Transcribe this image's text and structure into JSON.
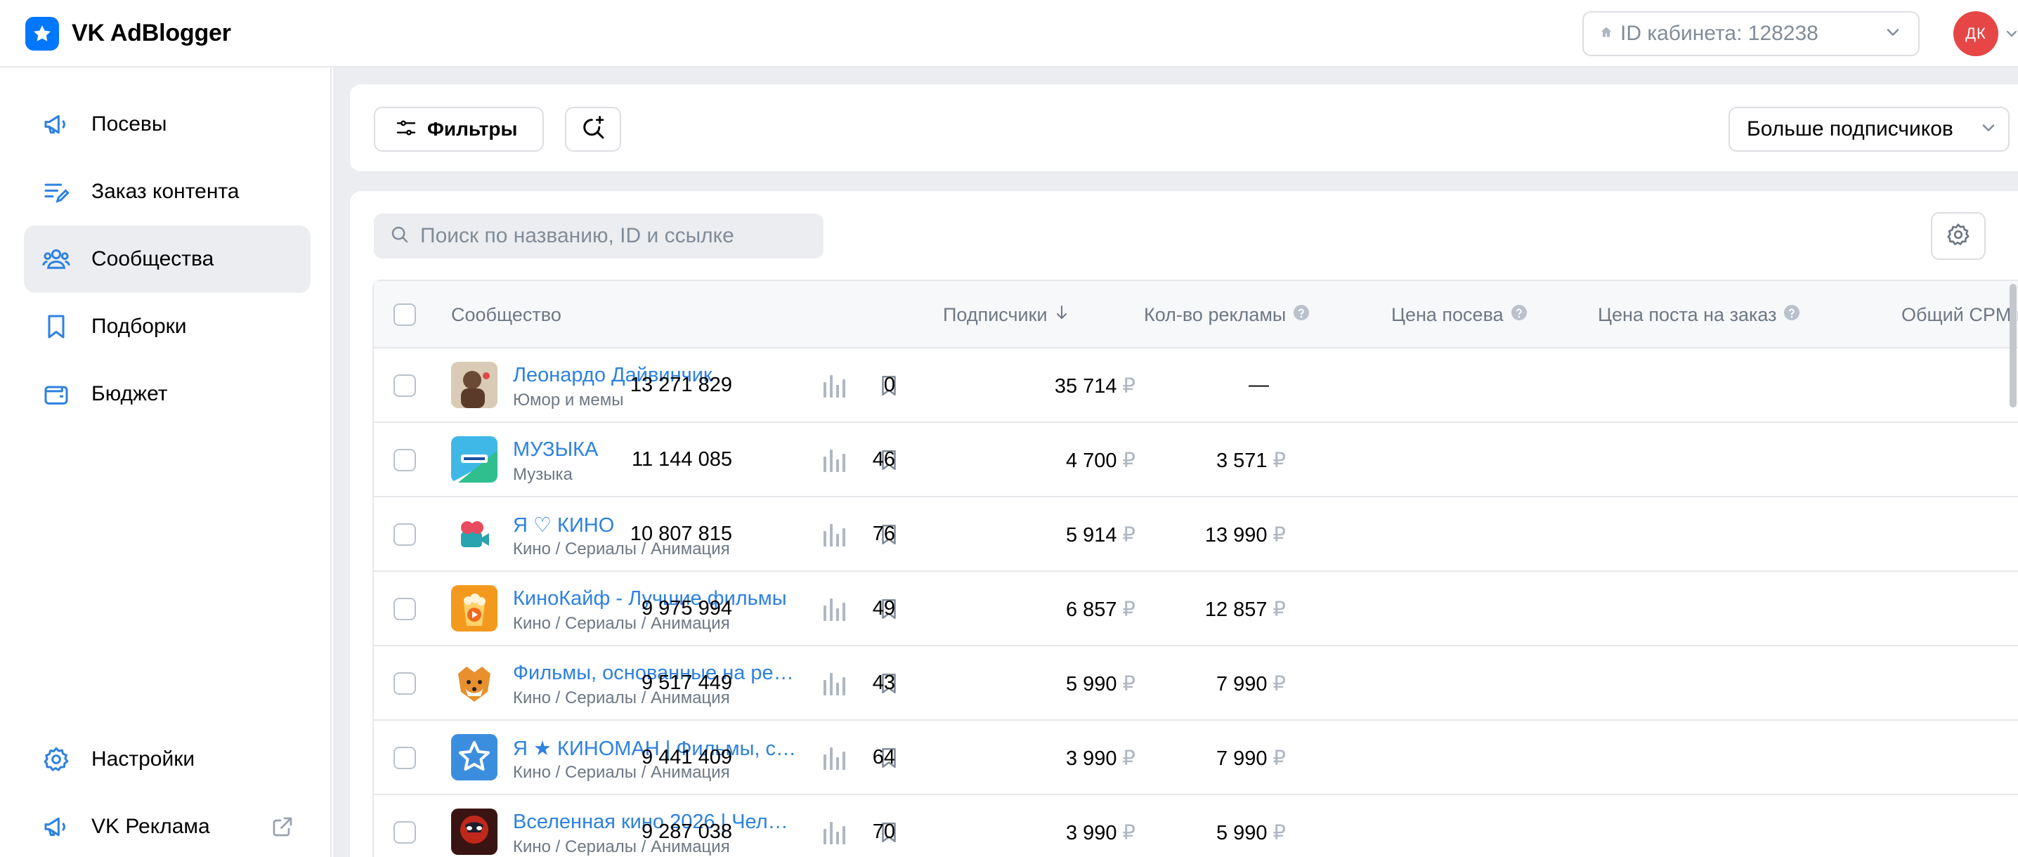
{
  "header": {
    "app_title": "VK AdBlogger",
    "cabinet_label": "ID кабинета: 128238",
    "avatar_initials": "ДК"
  },
  "sidebar": {
    "items": [
      {
        "label": "Посевы",
        "icon": "megaphone-icon",
        "active": false
      },
      {
        "label": "Заказ контента",
        "icon": "edit-list-icon",
        "active": false
      },
      {
        "label": "Сообщества",
        "icon": "users-icon",
        "active": true
      },
      {
        "label": "Подборки",
        "icon": "bookmark-icon",
        "active": false
      },
      {
        "label": "Бюджет",
        "icon": "wallet-icon",
        "active": false
      }
    ],
    "bottom_items": [
      {
        "label": "Настройки",
        "icon": "gear-icon"
      },
      {
        "label": "VK Реклама",
        "icon": "megaphone-icon",
        "external": true
      }
    ]
  },
  "toolbar": {
    "filters_label": "Фильтры",
    "sort_label": "Больше подписчиков"
  },
  "search": {
    "placeholder": "Поиск по названию, ID и ссылке"
  },
  "table": {
    "columns": {
      "community": "Сообщество",
      "subscribers": "Подписчики",
      "ads_count": "Кол-во рекламы",
      "seed_price": "Цена посева",
      "post_price": "Цена поста на заказ",
      "cpm": "Общий CPM п"
    },
    "currency": "₽",
    "rows": [
      {
        "name": "Леонардо Дайвинчик",
        "category": "Юмор и мемы",
        "subscribers": "13 271 829",
        "ads": "0",
        "seed_price": "35 714",
        "post_price": "—"
      },
      {
        "name": "МУЗЫКА",
        "category": "Музыка",
        "subscribers": "11 144 085",
        "ads": "46",
        "seed_price": "4 700",
        "post_price": "3 571"
      },
      {
        "name": "Я ♡ КИНО",
        "category": "Кино / Сериалы / Анимация",
        "subscribers": "10 807 815",
        "ads": "76",
        "seed_price": "5 914",
        "post_price": "13 990"
      },
      {
        "name": "КиноКайф - Лучшие фильмы",
        "category": "Кино / Сериалы / Анимация",
        "subscribers": "9 975 994",
        "ads": "49",
        "seed_price": "6 857",
        "post_price": "12 857"
      },
      {
        "name": "Фильмы, основанные на ре…",
        "category": "Кино / Сериалы / Анимация",
        "subscribers": "9 517 449",
        "ads": "43",
        "seed_price": "5 990",
        "post_price": "7 990"
      },
      {
        "name": "Я ★ КИНОМАН | Фильмы, с…",
        "category": "Кино / Сериалы / Анимация",
        "subscribers": "9 441 409",
        "ads": "64",
        "seed_price": "3 990",
        "post_price": "7 990"
      },
      {
        "name": "Вселенная кино 2026 | Чел…",
        "category": "Кино / Сериалы / Анимация",
        "subscribers": "9 287 038",
        "ads": "70",
        "seed_price": "3 990",
        "post_price": "5 990"
      }
    ]
  },
  "colors": {
    "accent": "#0077ff",
    "link": "#2d81e0",
    "avatar_bg": "#e64646",
    "muted": "#818c99",
    "page_bg": "#ebedf0"
  }
}
